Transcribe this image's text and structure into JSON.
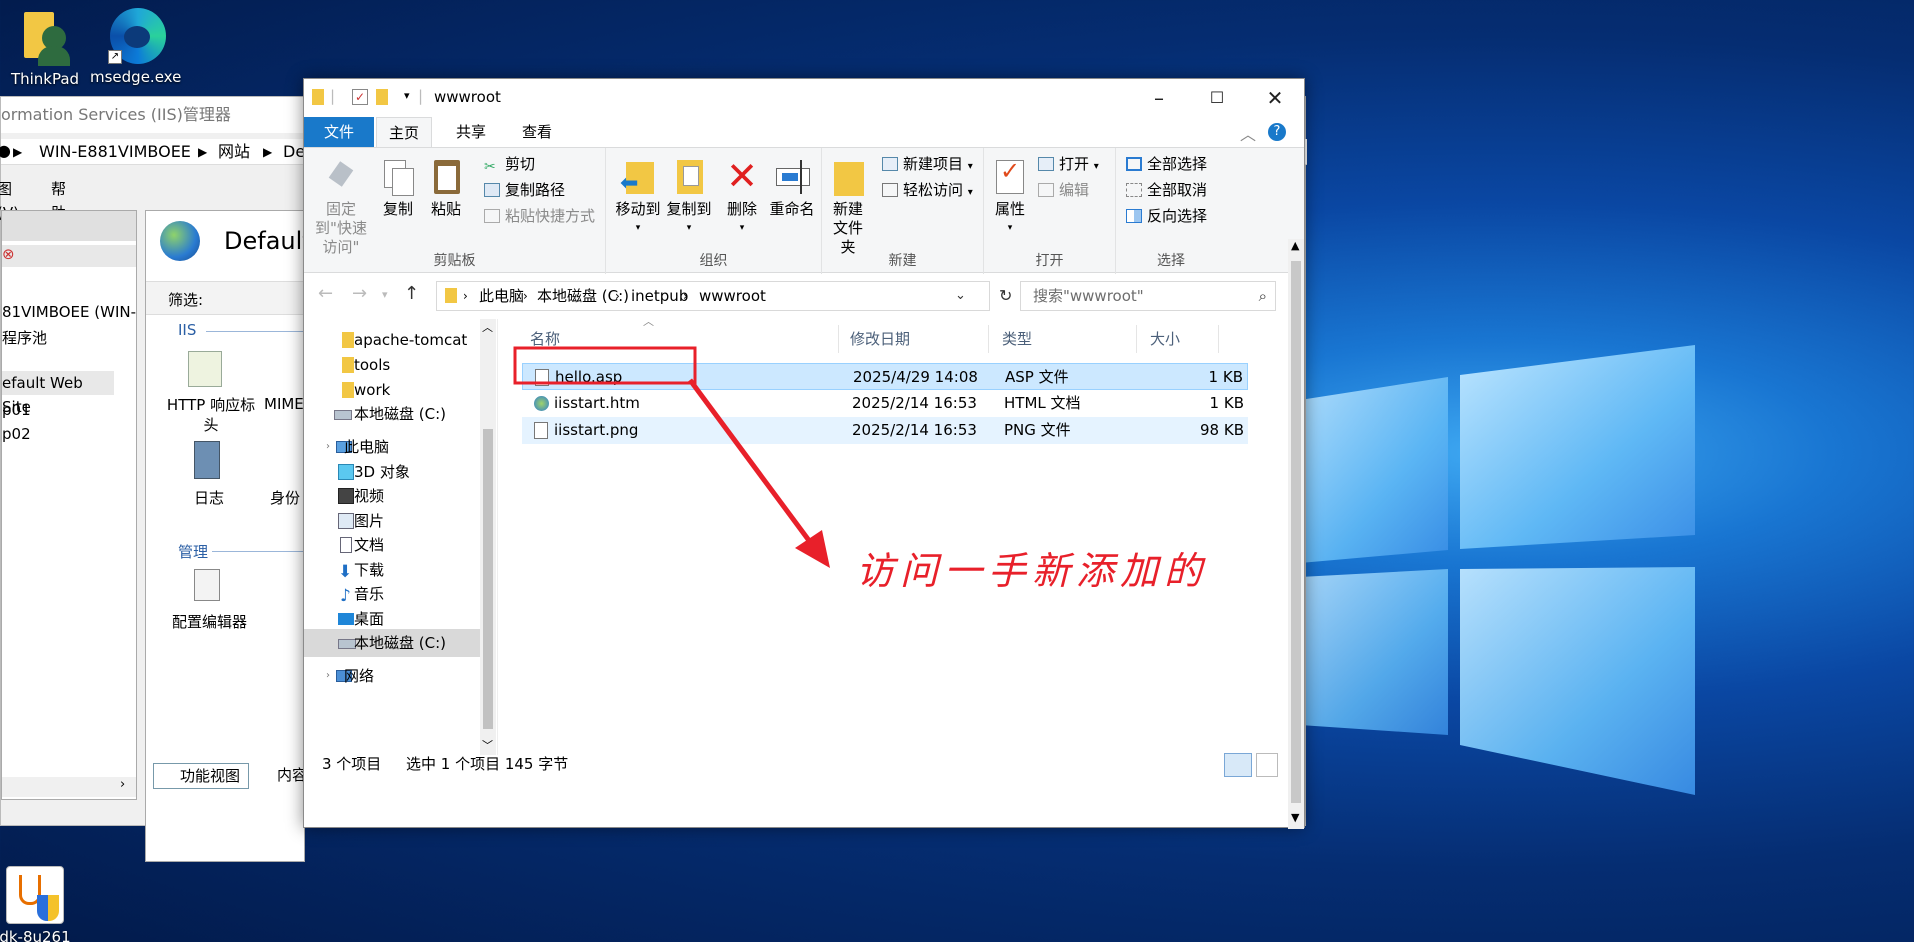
{
  "desktop": {
    "icons": [
      {
        "label": "ThinkPad",
        "icon": "folder-user-icon"
      },
      {
        "label": "msedge.exe",
        "icon": "edge-icon"
      },
      {
        "label": "dk-8u261",
        "icon": "java-installer-icon"
      }
    ]
  },
  "iis": {
    "title": "ormation Services (IIS)管理器",
    "breadcrumb": [
      "WIN-E881VIMBOEE",
      "网站",
      "De"
    ],
    "menu": [
      "图(V)",
      "帮助(H)"
    ],
    "tree": [
      "81VIMBOEE (WIN-",
      "程序池",
      "efault Web Site",
      "p01",
      "p02"
    ],
    "main_title": "Default",
    "filter_label": "筛选:",
    "group_iis": "IIS",
    "features": [
      "HTTP 响应标头",
      "MIME",
      "日志",
      "身份"
    ],
    "group_manage": "管理",
    "config_editor": "配置编辑器",
    "tabs": [
      "功能视图",
      "内容视图"
    ]
  },
  "explorer": {
    "title": "wwwroot",
    "ribbon_tabs": [
      "文件",
      "主页",
      "共享",
      "查看"
    ],
    "clipboard": {
      "pin": "固定到\"快速访问\"",
      "copy": "复制",
      "paste": "粘贴",
      "cut": "剪切",
      "copy_path": "复制路径",
      "paste_shortcut": "粘贴快捷方式",
      "label": "剪贴板"
    },
    "organize": {
      "move_to": "移动到",
      "copy_to": "复制到",
      "delete": "删除",
      "rename": "重命名",
      "label": "组织"
    },
    "new": {
      "new_folder": "新建\n文件夹",
      "new_item": "新建项目",
      "easy_access": "轻松访问",
      "label": "新建"
    },
    "open": {
      "properties": "属性",
      "open": "打开",
      "edit": "编辑",
      "label": "打开"
    },
    "select": {
      "select_all": "全部选择",
      "select_none": "全部取消",
      "invert": "反向选择",
      "label": "选择"
    },
    "path": [
      "此电脑",
      "本地磁盘 (C:)",
      "inetpub",
      "wwwroot"
    ],
    "search_placeholder": "搜索\"wwwroot\"",
    "nav": [
      {
        "label": "apache-tomcat",
        "icon": "folder-icon"
      },
      {
        "label": "tools",
        "icon": "folder-icon"
      },
      {
        "label": "work",
        "icon": "folder-icon"
      },
      {
        "label": "本地磁盘 (C:)",
        "icon": "drive-icon"
      },
      {
        "label": "此电脑",
        "icon": "pc-icon"
      },
      {
        "label": "3D 对象",
        "icon": "3d-objects-icon"
      },
      {
        "label": "视频",
        "icon": "video-icon"
      },
      {
        "label": "图片",
        "icon": "pictures-icon"
      },
      {
        "label": "文档",
        "icon": "documents-icon"
      },
      {
        "label": "下载",
        "icon": "download-icon"
      },
      {
        "label": "音乐",
        "icon": "music-icon"
      },
      {
        "label": "桌面",
        "icon": "desktop-icon"
      },
      {
        "label": "本地磁盘 (C:)",
        "icon": "drive-icon"
      },
      {
        "label": "网络",
        "icon": "network-icon"
      }
    ],
    "columns": [
      "名称",
      "修改日期",
      "类型",
      "大小"
    ],
    "files": [
      {
        "name": "hello.asp",
        "date": "2025/4/29 14:08",
        "type": "ASP 文件",
        "size": "1 KB"
      },
      {
        "name": "iisstart.htm",
        "date": "2025/2/14 16:53",
        "type": "HTML 文档",
        "size": "1 KB"
      },
      {
        "name": "iisstart.png",
        "date": "2025/2/14 16:53",
        "type": "PNG 文件",
        "size": "98 KB"
      }
    ],
    "status": {
      "count": "3 个项目",
      "selected": "选中 1 个项目  145 字节"
    }
  },
  "annotation": {
    "text": "访问一手新添加的",
    "color": "#e8202a"
  },
  "colors": {
    "accent": "#1979ca",
    "selection": "#cce8ff"
  }
}
